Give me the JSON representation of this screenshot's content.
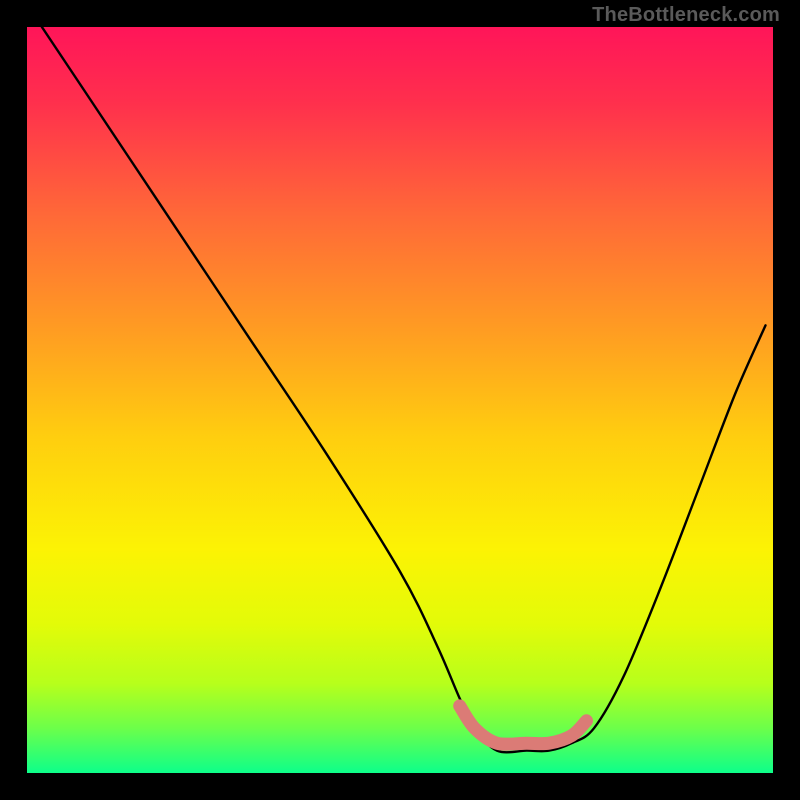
{
  "watermark": "TheBottleneck.com",
  "chart_data": {
    "type": "line",
    "title": "",
    "xlabel": "",
    "ylabel": "",
    "xlim": [
      0,
      100
    ],
    "ylim": [
      0,
      100
    ],
    "grid": false,
    "legend": false,
    "series": [
      {
        "name": "bottleneck-curve",
        "x": [
          2,
          10,
          20,
          30,
          40,
          50,
          55,
          58,
          60,
          63,
          67,
          70,
          73,
          76,
          80,
          85,
          90,
          95,
          99
        ],
        "y": [
          100,
          88,
          73,
          58,
          43,
          27,
          17,
          10,
          6,
          3,
          3,
          3,
          4,
          6,
          13,
          25,
          38,
          51,
          60
        ],
        "color": "#000000"
      },
      {
        "name": "optimal-range",
        "x": [
          58,
          60,
          63,
          67,
          70,
          73,
          75
        ],
        "y": [
          9,
          6,
          4,
          4,
          4,
          5,
          7
        ],
        "color": "#db7b76"
      }
    ],
    "background_gradient": {
      "type": "vertical",
      "stops": [
        {
          "offset": 0.0,
          "color": "#ff1559"
        },
        {
          "offset": 0.1,
          "color": "#ff2f4d"
        },
        {
          "offset": 0.25,
          "color": "#ff6838"
        },
        {
          "offset": 0.4,
          "color": "#ff9a23"
        },
        {
          "offset": 0.55,
          "color": "#ffce0f"
        },
        {
          "offset": 0.7,
          "color": "#fcf304"
        },
        {
          "offset": 0.8,
          "color": "#e3fb08"
        },
        {
          "offset": 0.88,
          "color": "#b7ff1b"
        },
        {
          "offset": 0.94,
          "color": "#6cff4a"
        },
        {
          "offset": 1.0,
          "color": "#0dff8a"
        }
      ]
    }
  }
}
